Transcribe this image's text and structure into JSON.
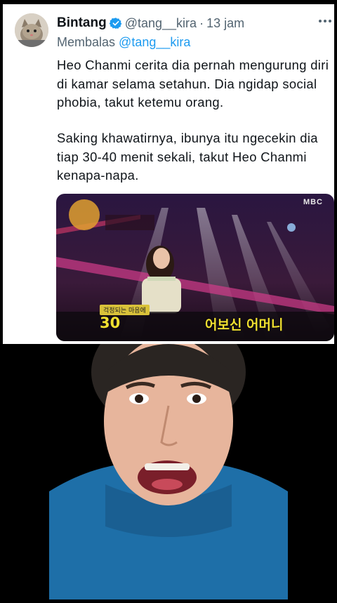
{
  "tweet": {
    "author_name": "Bintang",
    "handle": "@tang__kira",
    "separator": "·",
    "time": "13 jam",
    "reply_prefix": "Membalas",
    "reply_to": "@tang__kira",
    "paragraphs": [
      "Heo Chanmi cerita dia pernah mengurung diri di kamar selama setahun. Dia ngidap social phobia, takut ketemu orang.",
      "Saking khawatirnya, ibunya itu ngecekin dia tiap 30-40 menit sekali, takut Heo Chanmi kenapa-napa."
    ],
    "icons": {
      "verified": "verified-badge-icon",
      "more": "more-options-icon"
    },
    "colors": {
      "link": "#1d9bf0",
      "muted": "#536471",
      "text": "#0f1419"
    }
  },
  "media": {
    "watermark": "MBC",
    "caption_tag": "걱정되는 마음에",
    "caption_left": "30",
    "caption_right": "어보신 어머니"
  }
}
